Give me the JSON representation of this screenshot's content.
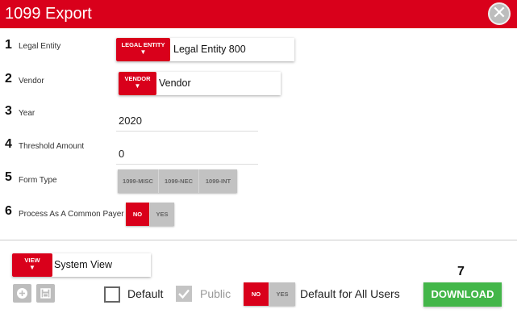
{
  "dialog": {
    "title": "1099 Export",
    "close_icon": "close-icon"
  },
  "steps": [
    {
      "num": "1",
      "label": "Legal Entity"
    },
    {
      "num": "2",
      "label": "Vendor"
    },
    {
      "num": "3",
      "label": "Year"
    },
    {
      "num": "4",
      "label": "Threshold Amount"
    },
    {
      "num": "5",
      "label": "Form Type"
    },
    {
      "num": "6",
      "label": "Process As A Common Payer"
    }
  ],
  "legal_entity": {
    "tag": "LEGAL ENTITY",
    "arrow": "▼",
    "value": "Legal Entity 800"
  },
  "vendor": {
    "tag": "VENDOR",
    "arrow": "▼",
    "value": "Vendor"
  },
  "year": {
    "value": "2020"
  },
  "threshold": {
    "value": "0"
  },
  "form_type": {
    "options": [
      "1099-MISC",
      "1099-NEC",
      "1099-INT"
    ]
  },
  "common_payer": {
    "options": [
      "NO",
      "YES"
    ],
    "selected": "NO"
  },
  "view": {
    "tag": "VIEW",
    "arrow": "▼",
    "value": "System View"
  },
  "footer": {
    "default_label": "Default",
    "public_label": "Public",
    "all_users_toggle": [
      "NO",
      "YES"
    ],
    "all_users_label": "Default for All Users",
    "step_num": "7",
    "download_label": "DOWNLOAD"
  },
  "colors": {
    "brand": "#d9001b",
    "download": "#43b649",
    "inactive": "#c2c2c2"
  }
}
